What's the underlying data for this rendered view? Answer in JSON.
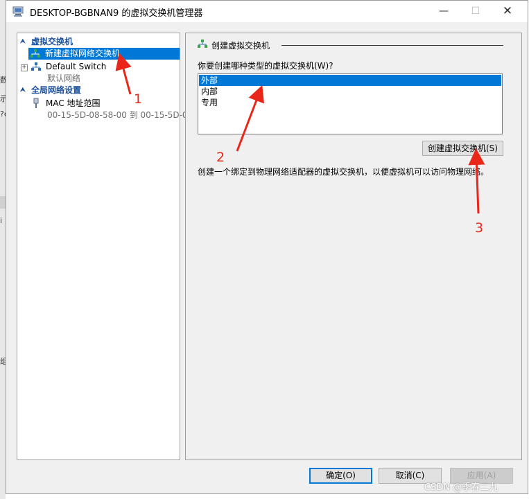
{
  "window": {
    "title": "DESKTOP-BGBNAN9 的虚拟交换机管理器",
    "min_glyph": "—",
    "max_glyph": "☐",
    "close_glyph": "✕"
  },
  "background": {
    "mark1": "数",
    "mark2": "示",
    "mark3": "?c",
    "mark4": "i",
    "mark5": "组"
  },
  "left_pane": {
    "section1": {
      "label": "虚拟交换机",
      "icon": "chevron-up-icon"
    },
    "new_switch": {
      "label": "新建虚拟网络交换机",
      "icon": "network-switch-add-icon"
    },
    "default_switch": {
      "label": "Default Switch",
      "sub": "默认网络",
      "expander": "+",
      "icon": "network-switch-icon"
    },
    "section2": {
      "label": "全局网络设置",
      "icon": "chevron-up-icon"
    },
    "mac_range": {
      "label": "MAC 地址范围",
      "sub": "00-15-5D-08-58-00 到 00-15-5D-0...",
      "icon": "network-plug-icon"
    }
  },
  "right_pane": {
    "group_title": "创建虚拟交换机",
    "question": "你要创建哪种类型的虚拟交换机(W)?",
    "options": [
      "外部",
      "内部",
      "专用"
    ],
    "selected_option": "外部",
    "create_button": "创建虚拟交换机(S)",
    "description": "创建一个绑定到物理网络适配器的虚拟交换机，以便虚拟机可以访问物理网络。"
  },
  "footer": {
    "ok": "确定(O)",
    "cancel": "取消(C)",
    "apply": "应用(A)"
  },
  "annotations": {
    "n1": "1",
    "n2": "2",
    "n3": "3",
    "arrow_color": "#e8271a"
  },
  "watermark": "CSDN @季春二九"
}
